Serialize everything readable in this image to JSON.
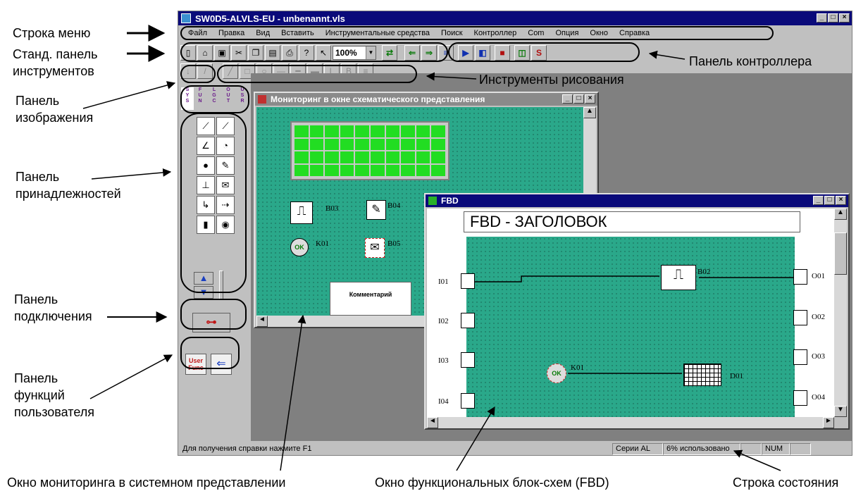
{
  "app": {
    "title": "SW0D5-ALVLS-EU - unbenannt.vls",
    "menu": [
      "Файл",
      "Правка",
      "Вид",
      "Вставить",
      "Инструментальные средства",
      "Поиск",
      "Контроллер",
      "Com",
      "Опция",
      "Окно",
      "Справка"
    ],
    "zoom": "100%",
    "status": {
      "hint": "Для получения справки нажмите F1",
      "series": "Серии AL",
      "usage": "6% использовано",
      "num": "NUM"
    }
  },
  "annotations": {
    "menu_bar": "Строка меню",
    "std_toolbar_1": "Станд. панель",
    "std_toolbar_2": "инструментов",
    "controller_toolbar": "Панель контроллера",
    "drawing_tools": "Инструменты рисования",
    "image_panel_1": "Панель",
    "image_panel_2": "изображения",
    "accessories_panel_1": "Панель",
    "accessories_panel_2": "принадлежностей",
    "connection_panel_1": "Панель",
    "connection_panel_2": "подключения",
    "user_func_panel_1": "Панель",
    "user_func_panel_2": "функций",
    "user_func_panel_3": "пользователя",
    "monitor_window": "Окно мониторинга в системном представлении",
    "fbd_window": "Окно функциональных блок-схем (FBD)",
    "status_bar": "Строка состояния"
  },
  "monitor_window": {
    "title": "Мониторинг в окне схематического представления",
    "blocks": [
      "B03",
      "B04",
      "K01",
      "B05"
    ],
    "comment": "Комментарий"
  },
  "fbd_window": {
    "title": "FBD",
    "header": "FBD - ЗАГОЛОВОК",
    "inputs": [
      "I01",
      "I02",
      "I03",
      "I04"
    ],
    "outputs": [
      "O01",
      "O02",
      "O03",
      "O04"
    ],
    "blocks": [
      "B02",
      "K01",
      "D01"
    ]
  },
  "user_func_label_1": "User",
  "user_func_label_2": "Func",
  "colors": {
    "title_active": "#0a0a7a",
    "canvas": "#2aa88a",
    "lcd": "#22dd22"
  }
}
